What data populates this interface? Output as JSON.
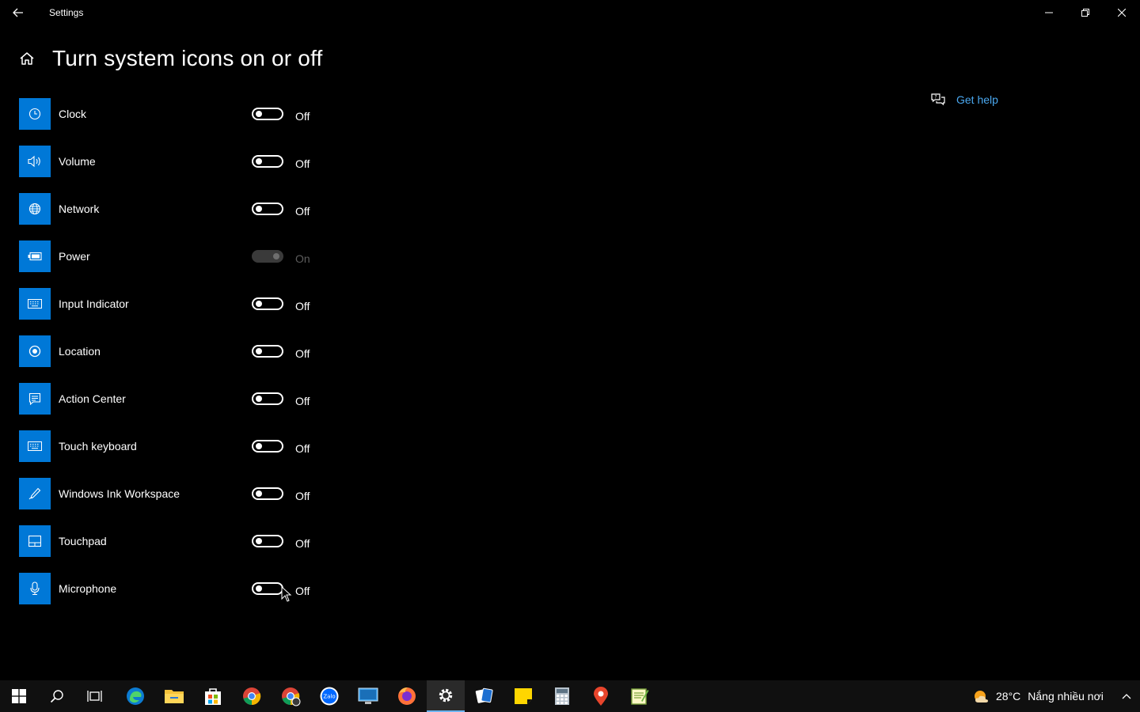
{
  "window": {
    "title": "Settings"
  },
  "page": {
    "title": "Turn system icons on or off"
  },
  "settings": [
    {
      "label": "Clock",
      "state": "Off",
      "on": false,
      "disabled": false,
      "icon": "clock-icon"
    },
    {
      "label": "Volume",
      "state": "Off",
      "on": false,
      "disabled": false,
      "icon": "volume-icon"
    },
    {
      "label": "Network",
      "state": "Off",
      "on": false,
      "disabled": false,
      "icon": "globe-icon"
    },
    {
      "label": "Power",
      "state": "On",
      "on": true,
      "disabled": true,
      "icon": "battery-icon"
    },
    {
      "label": "Input Indicator",
      "state": "Off",
      "on": false,
      "disabled": false,
      "icon": "keyboard-icon"
    },
    {
      "label": "Location",
      "state": "Off",
      "on": false,
      "disabled": false,
      "icon": "location-icon"
    },
    {
      "label": "Action Center",
      "state": "Off",
      "on": false,
      "disabled": false,
      "icon": "action-center-icon"
    },
    {
      "label": "Touch keyboard",
      "state": "Off",
      "on": false,
      "disabled": false,
      "icon": "keyboard-icon"
    },
    {
      "label": "Windows Ink Workspace",
      "state": "Off",
      "on": false,
      "disabled": false,
      "icon": "pen-icon"
    },
    {
      "label": "Touchpad",
      "state": "Off",
      "on": false,
      "disabled": false,
      "icon": "touchpad-icon"
    },
    {
      "label": "Microphone",
      "state": "Off",
      "on": false,
      "disabled": false,
      "icon": "microphone-icon"
    }
  ],
  "help": {
    "label": "Get help"
  },
  "taskbar": {
    "apps": [
      "start",
      "search",
      "task-view",
      "edge",
      "file-explorer",
      "store",
      "chrome",
      "chrome-profile",
      "zalo",
      "remote-desktop",
      "firefox",
      "settings",
      "solitaire",
      "sticky-notes",
      "calculator",
      "maps",
      "notepad-plus"
    ],
    "weather_temp": "28°C",
    "weather_text": "Nắng nhiều nơi"
  },
  "colors": {
    "accent": "#0078d7",
    "link": "#4aa8f0",
    "background": "#000000",
    "taskbar": "#101010"
  }
}
